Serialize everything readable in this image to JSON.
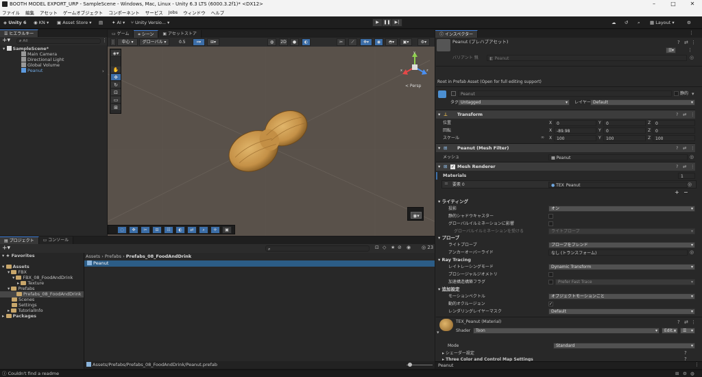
{
  "window": {
    "title": "BOOTH MODEL EXPORT_URP - SampleScene - Windows, Mac, Linux - Unity 6.3 LTS (6000.3.2f1)* <DX12>"
  },
  "menu": [
    "ファイル",
    "編集",
    "アセット",
    "ゲームオブジェクト",
    "コンポーネント",
    "サービス",
    "Jobs",
    "ウィンドウ",
    "ヘルプ"
  ],
  "toolbar": {
    "unity": "Unity 6",
    "account": "KN",
    "asset_store": "Asset Store",
    "ai": "AI",
    "version": "Unity Versio...",
    "layout": "Layout"
  },
  "hierarchy": {
    "tab": "ヒエラルキー",
    "search_placeholder": "All",
    "scene": "SampleScene*",
    "items": [
      "Main Camera",
      "Directional Light",
      "Global Volume",
      "Peanut"
    ]
  },
  "scene_tabs": [
    "ゲーム",
    "シーン",
    "アセットストア"
  ],
  "scene_toolbar": {
    "pivot": "中心",
    "space": "グローバル",
    "snap": "0.5"
  },
  "scene": {
    "persp": "< Persp",
    "gizmo_axes": [
      "x",
      "y",
      "z"
    ]
  },
  "project": {
    "tabs": [
      "プロジェクト",
      "コンソール"
    ],
    "count": "23",
    "tree": [
      {
        "label": "Favorites",
        "level": 0,
        "bold": true,
        "icon": "star"
      },
      {
        "label": "Assets",
        "level": 0,
        "bold": true,
        "icon": "folder"
      },
      {
        "label": "FBX",
        "level": 1,
        "icon": "folder"
      },
      {
        "label": "FBX_08_FoodAndDrink",
        "level": 2,
        "icon": "folder"
      },
      {
        "label": "Texture",
        "level": 3,
        "icon": "folder"
      },
      {
        "label": "Prefabs",
        "level": 1,
        "icon": "folder"
      },
      {
        "label": "Prefabs_08_FoodAndDrink",
        "level": 2,
        "icon": "folder",
        "selected": true
      },
      {
        "label": "Scenes",
        "level": 1,
        "icon": "folder"
      },
      {
        "label": "Settings",
        "level": 1,
        "icon": "folder"
      },
      {
        "label": "TutorialInfo",
        "level": 1,
        "icon": "folder"
      },
      {
        "label": "Packages",
        "level": 0,
        "bold": true,
        "icon": "folder"
      }
    ],
    "breadcrumb": [
      "Assets",
      "Prefabs",
      "Prefabs_08_FoodAndDrink"
    ],
    "asset": "Peanut",
    "path": "Assets/Prefabs/Prefabs_08_FoodAndDrink/Peanut.prefab"
  },
  "inspector": {
    "tab": "インスペクター",
    "title": "Peanut (プレハブアセット)",
    "variant_label": "バリアント 親",
    "variant_value": "Peanut",
    "root_note": "Root in Prefab Asset (Open for full editing support)",
    "name": "Peanut",
    "static": "静的",
    "tag_label": "タグ",
    "tag": "Untagged",
    "layer_label": "レイヤー",
    "layer": "Default",
    "transform": {
      "title": "Transform",
      "labels": [
        "位置",
        "回転",
        "スケール"
      ],
      "position": [
        "0",
        "0",
        "0"
      ],
      "rotation": [
        "-89.98",
        "0",
        "0"
      ],
      "scale": [
        "100",
        "100",
        "100"
      ]
    },
    "mesh_filter": {
      "title": "Peanut (Mesh Filter)",
      "label": "メッシュ",
      "value": "Peanut"
    },
    "mesh_renderer": {
      "title": "Mesh Renderer",
      "materials_label": "Materials",
      "materials_count": "1",
      "element_label": "要素 0",
      "element_value": "TEX_Peanut",
      "lighting": "ライティング",
      "cast_label": "投影",
      "cast_value": "オン",
      "static_shadow": "静的シャドウキャスター",
      "gi_label": "グローバルイルミネーションに影響",
      "gi_recv_label": "グローバルイルミネーションを受ける",
      "gi_recv_value": "ライトプローブ",
      "probes": "プローブ",
      "light_probe_label": "ライトプローブ",
      "light_probe_value": "プローブをブレンド",
      "anchor_label": "アンカーオーバーライド",
      "anchor_value": "なし (トランスフォーム)",
      "raytracing": "Ray Tracing",
      "rt_mode_label": "レイトレーシングモード",
      "rt_mode_value": "Dynamic Transform",
      "procedural_label": "プロシージャルジオメトリ",
      "accel_label": "加速構造構築フラグ",
      "accel_value": "Prefer Fast Trace",
      "additional": "追加設定",
      "motion_label": "モーションベクトル",
      "motion_value": "オブジェクトモーションごと",
      "occlusion_label": "動的オクルージョン",
      "mask_label": "レンダリングレイヤーマスク",
      "mask_value": "Default"
    },
    "material": {
      "title": "TEX_Peanut (Material)",
      "shader_label": "Shader",
      "shader_value": "Toon",
      "edit": "Edit...",
      "mode_label": "Mode",
      "mode_value": "Standard",
      "shader_settings": "シェーダー設定",
      "three_color": "Three Color and Control Map Settings"
    },
    "footer": "Peanut"
  },
  "status": {
    "message": "Couldn't find a readme"
  },
  "colors": {
    "accent": "#3c6ea8",
    "selection": "#2c5d87",
    "scene_bg": "#59514a",
    "peanut": "#c9974a"
  }
}
